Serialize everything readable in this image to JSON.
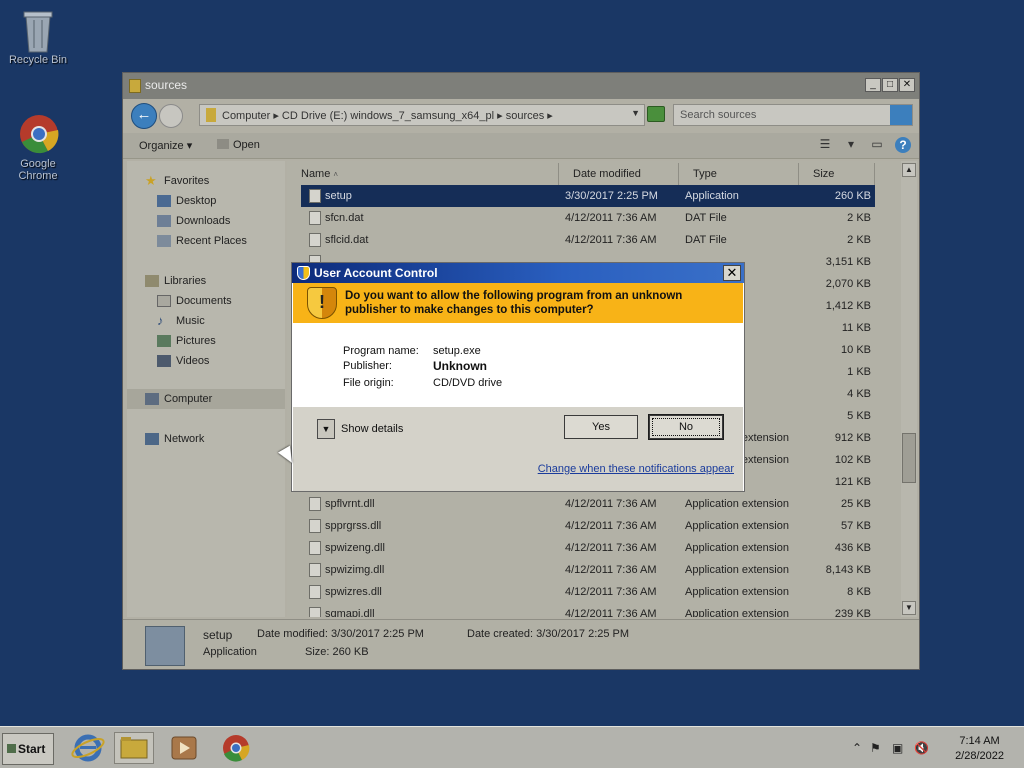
{
  "desktop": {
    "icons": [
      {
        "label": "Recycle Bin",
        "icon": "recycle-bin-icon"
      },
      {
        "label": "Google Chrome",
        "icon": "chrome-icon"
      }
    ]
  },
  "explorer": {
    "title": "sources",
    "breadcrumb": "Computer  ▸  CD Drive (E:) windows_7_samsung_x64_pl  ▸  sources  ▸",
    "search_placeholder": "Search sources",
    "toolbar": {
      "organize": "Organize ▾",
      "open": "Open"
    },
    "nav": {
      "favorites": "Favorites",
      "desktop": "Desktop",
      "downloads": "Downloads",
      "recent": "Recent Places",
      "libraries": "Libraries",
      "documents": "Documents",
      "music": "Music",
      "pictures": "Pictures",
      "videos": "Videos",
      "computer": "Computer",
      "network": "Network"
    },
    "columns": {
      "name": "Name",
      "date": "Date modified",
      "type": "Type",
      "size": "Size"
    },
    "files": [
      {
        "name": "setup",
        "date": "3/30/2017 2:25 PM",
        "type": "Application",
        "size": "260 KB"
      },
      {
        "name": "sfcn.dat",
        "date": "4/12/2011 7:36 AM",
        "type": "DAT File",
        "size": "2 KB"
      },
      {
        "name": "sflcid.dat",
        "date": "4/12/2011 7:36 AM",
        "type": "DAT File",
        "size": "2 KB"
      },
      {
        "name": "",
        "date": "",
        "type": "",
        "size": "3,151 KB"
      },
      {
        "name": "",
        "date": "",
        "type": "",
        "size": "2,070 KB"
      },
      {
        "name": "",
        "date": "",
        "type": "",
        "size": "1,412 KB"
      },
      {
        "name": "",
        "date": "",
        "type": "ation",
        "size": "11 KB"
      },
      {
        "name": "",
        "date": "",
        "type": "ation",
        "size": "10 KB"
      },
      {
        "name": "",
        "date": "",
        "type": "ation",
        "size": "1 KB"
      },
      {
        "name": "",
        "date": "",
        "type": "ation",
        "size": "4 KB"
      },
      {
        "name": "",
        "date": "",
        "type": "ation",
        "size": "5 KB"
      },
      {
        "name": "",
        "date": "",
        "type": "Application extension",
        "size": "912 KB"
      },
      {
        "name": "",
        "date": "",
        "type": "Application extension",
        "size": "102 KB"
      },
      {
        "name": "",
        "date": "",
        "type": "",
        "size": "121 KB"
      },
      {
        "name": "spflvrnt.dll",
        "date": "4/12/2011 7:36 AM",
        "type": "Application extension",
        "size": "25 KB"
      },
      {
        "name": "spprgrss.dll",
        "date": "4/12/2011 7:36 AM",
        "type": "Application extension",
        "size": "57 KB"
      },
      {
        "name": "spwizeng.dll",
        "date": "4/12/2011 7:36 AM",
        "type": "Application extension",
        "size": "436 KB"
      },
      {
        "name": "spwizimg.dll",
        "date": "4/12/2011 7:36 AM",
        "type": "Application extension",
        "size": "8,143 KB"
      },
      {
        "name": "spwizres.dll",
        "date": "4/12/2011 7:36 AM",
        "type": "Application extension",
        "size": "8 KB"
      },
      {
        "name": "sqmapi.dll",
        "date": "4/12/2011 7:36 AM",
        "type": "Application extension",
        "size": "239 KB"
      }
    ],
    "details": {
      "name": "setup",
      "kind": "Application",
      "date_modified": "Date modified:  3/30/2017 2:25 PM",
      "date_created": "Date created:  3/30/2017 2:25 PM",
      "size": "Size:  260 KB"
    }
  },
  "uac": {
    "title": "User Account Control",
    "close": "✕",
    "question": "Do you want to allow the following program from an unknown publisher to make changes to this computer?",
    "program_name_label": "Program name:",
    "program_name": "setup.exe",
    "publisher_label": "Publisher:",
    "publisher": "Unknown",
    "origin_label": "File origin:",
    "origin": "CD/DVD drive",
    "show_details": "Show details",
    "yes": "Yes",
    "no": "No",
    "link": "Change when these notifications appear"
  },
  "taskbar": {
    "start": "Start",
    "time": "7:14 AM",
    "date": "2/28/2022"
  }
}
